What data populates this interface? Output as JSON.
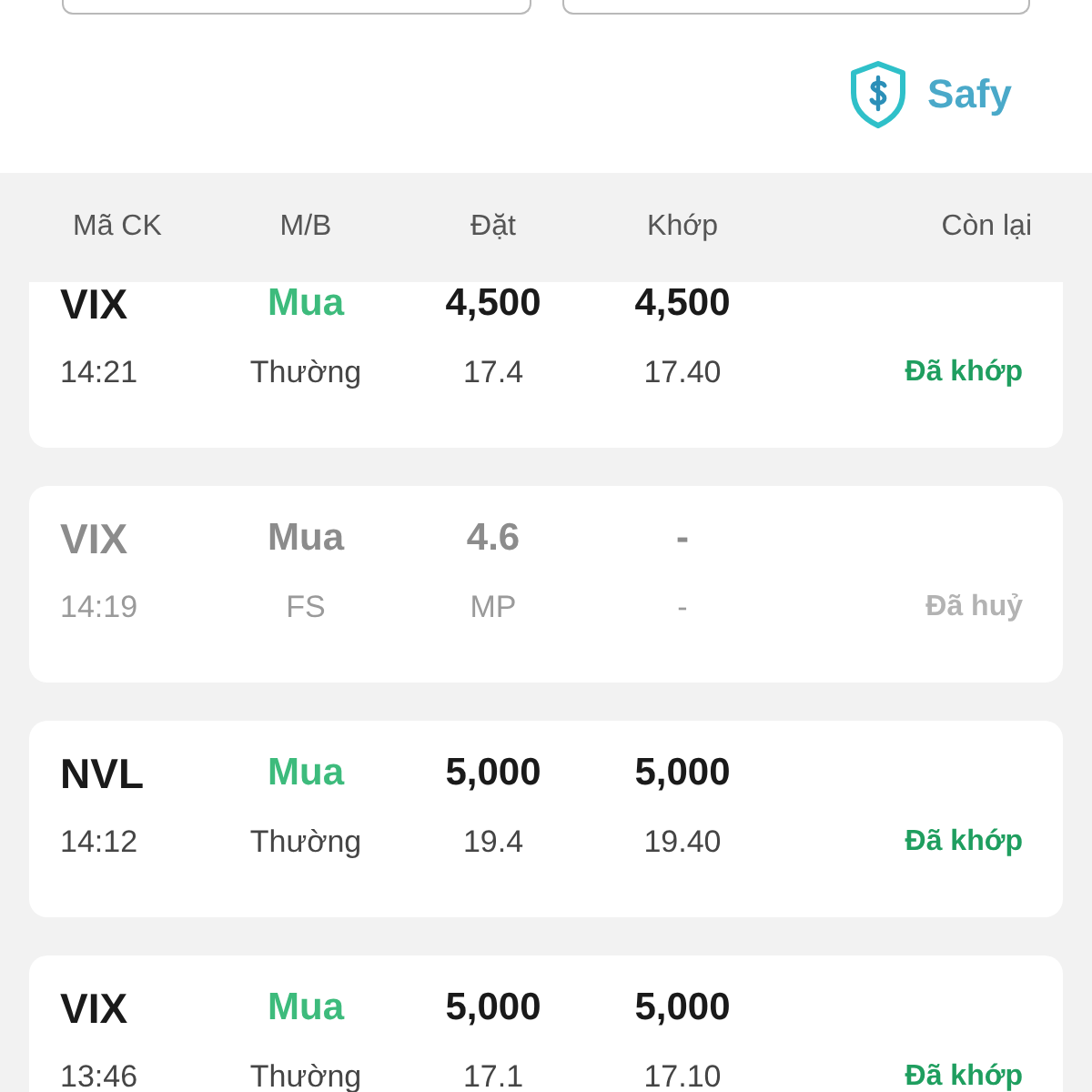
{
  "brand": {
    "name": "Safy"
  },
  "table": {
    "columns": [
      "Mã CK",
      "M/B",
      "Đặt",
      "Khớp",
      "Còn lại"
    ],
    "orders": [
      {
        "symbol": "VIX",
        "side": "Mua",
        "order_qty": "4,500",
        "matched_qty": "4,500",
        "time": "14:21",
        "order_type": "Thường",
        "order_price": "17.4",
        "matched_price": "17.40",
        "status": "Đã khớp",
        "cancelled": false
      },
      {
        "symbol": "VIX",
        "side": "Mua",
        "order_qty": "4.6",
        "matched_qty": "-",
        "time": "14:19",
        "order_type": "FS",
        "order_price": "MP",
        "matched_price": "-",
        "status": "Đã huỷ",
        "cancelled": true
      },
      {
        "symbol": "NVL",
        "side": "Mua",
        "order_qty": "5,000",
        "matched_qty": "5,000",
        "time": "14:12",
        "order_type": "Thường",
        "order_price": "19.4",
        "matched_price": "19.40",
        "status": "Đã khớp",
        "cancelled": false
      },
      {
        "symbol": "VIX",
        "side": "Mua",
        "order_qty": "5,000",
        "matched_qty": "5,000",
        "time": "13:46",
        "order_type": "Thường",
        "order_price": "17.1",
        "matched_price": "17.10",
        "status": "Đã khớp",
        "cancelled": false
      }
    ]
  }
}
